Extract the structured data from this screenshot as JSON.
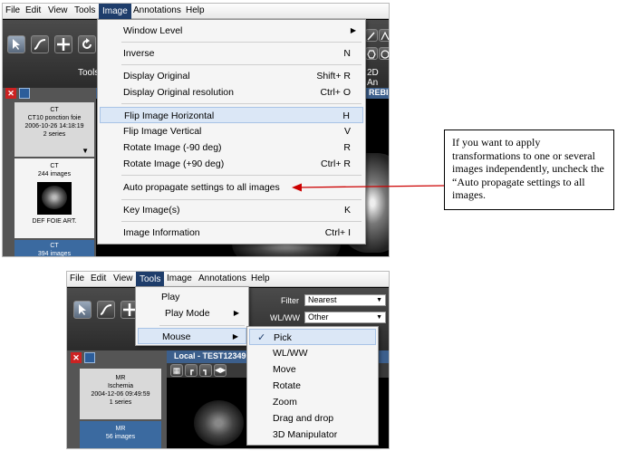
{
  "top_screenshot": {
    "menubar": [
      "File",
      "Edit",
      "View",
      "Tools",
      "Image",
      "Annotations",
      "Help"
    ],
    "active_menu": "Image",
    "toolbar_label": "Tools",
    "toolbar_right_label": "2D An",
    "viewer_title_fragment": "REBID",
    "series": [
      {
        "lines": [
          "CT",
          "CT10 ponction foie",
          "2006-10-26 14:18:19",
          "2 series"
        ]
      },
      {
        "lines": [
          "CT",
          "244 images"
        ],
        "caption": "DEF FOIE ART."
      },
      {
        "lines": [
          "CT",
          "394 images"
        ]
      }
    ],
    "image_menu": {
      "items": [
        {
          "label": "Window Level",
          "shortcut": "",
          "submenu": true
        },
        {
          "label": "Inverse",
          "shortcut": "N"
        },
        {
          "label": "Display Original",
          "shortcut": "Shift+ R"
        },
        {
          "label": "Display Original resolution",
          "shortcut": "Ctrl+ O"
        },
        {
          "label": "Flip Image Horizontal",
          "shortcut": "H",
          "highlighted": true
        },
        {
          "label": "Flip Image Vertical",
          "shortcut": "V"
        },
        {
          "label": "Rotate Image (-90 deg)",
          "shortcut": "R"
        },
        {
          "label": "Rotate Image (+90 deg)",
          "shortcut": "Ctrl+ R"
        },
        {
          "label": "Auto propagate settings to all images",
          "shortcut": ""
        },
        {
          "label": "Key Image(s)",
          "shortcut": "K"
        },
        {
          "label": "Image Information",
          "shortcut": "Ctrl+ I"
        }
      ]
    }
  },
  "callout": {
    "text": "If you want to apply transformations to one or several images independently, uncheck the “Auto propagate settings to all images.",
    "arrow_color": "#cc0000"
  },
  "bottom_screenshot": {
    "menubar": [
      "File",
      "Edit",
      "View",
      "Tools",
      "Image",
      "Annotations",
      "Help"
    ],
    "active_menu": "Tools",
    "filter_label": "Filter",
    "filter_value": "Nearest",
    "wlww_label": "WL/WW",
    "wlww_value": "Other",
    "viewer_title": "Local - TEST12349 -",
    "series": [
      {
        "lines": [
          "MR",
          "Ischemia",
          "2004-12-06 09:49:59",
          "1 series"
        ]
      },
      {
        "lines": [
          "MR",
          "56 images"
        ]
      }
    ],
    "tools_menu": {
      "items": [
        {
          "label": "Play"
        },
        {
          "label": "Play Mode",
          "submenu": true
        },
        {
          "label": "Mouse",
          "submenu": true,
          "highlighted": true
        }
      ]
    },
    "mouse_submenu": {
      "items": [
        {
          "label": "Pick",
          "checked": true,
          "highlighted": true
        },
        {
          "label": "WL/WW"
        },
        {
          "label": "Move"
        },
        {
          "label": "Rotate"
        },
        {
          "label": "Zoom"
        },
        {
          "label": "Drag and drop"
        },
        {
          "label": "3D Manipulator"
        }
      ]
    }
  },
  "colors": {
    "menu_highlight": "#dbe7f6",
    "active_menu_bg": "#1e3d6b",
    "selected_series": "#3b6aa0",
    "close_red": "#cc2222"
  }
}
